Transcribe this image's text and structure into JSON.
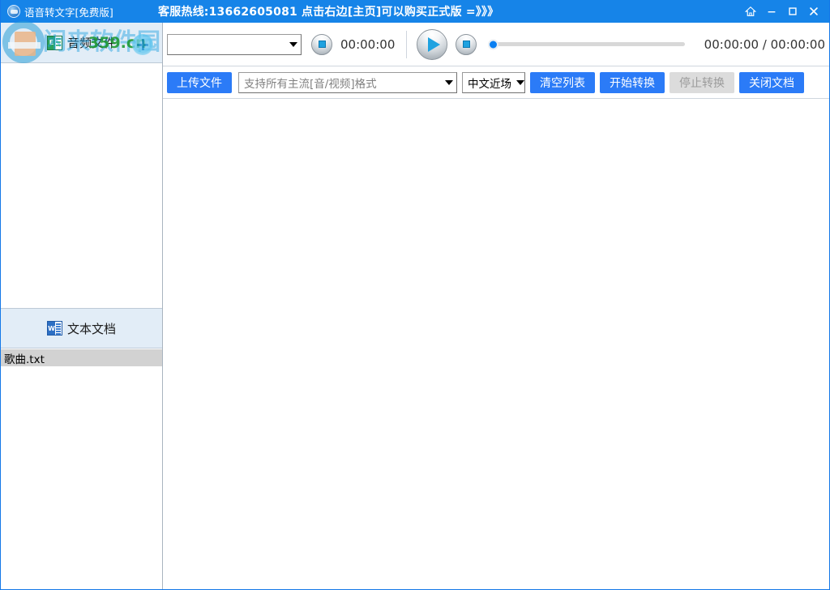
{
  "window": {
    "app_title": "语音转文字[免费版]",
    "banner": "客服热线:13662605081  点击右边[主页]可以购买正式版 =》》》",
    "titlebar_color": "#1684e8",
    "controls": [
      {
        "name": "home",
        "icon": "home-icon"
      },
      {
        "name": "minimize",
        "icon": "minimize-icon"
      },
      {
        "name": "maximize",
        "icon": "maximize-icon"
      },
      {
        "name": "close",
        "icon": "close-icon"
      }
    ]
  },
  "watermark": {
    "brand": "闲来软件园",
    "site": "359.cn",
    "logo": "logo-icon"
  },
  "sidebar": {
    "audio_panel": {
      "title": "音频文件",
      "icon": "audio-file-icon",
      "items": []
    },
    "doc_panel": {
      "title": "文本文档",
      "icon": "word-document-icon",
      "items": [
        {
          "label": "歌曲.txt",
          "selected": true
        }
      ]
    }
  },
  "player": {
    "track_select": {
      "value": "",
      "placeholder": ""
    },
    "stop_small_icon": "stop-icon",
    "elapsed": "00:00:00",
    "play_icon": "play-icon",
    "stop_icon": "stop-icon",
    "progress_percent": 0,
    "time_display": "00:00:00 / 00:00:00"
  },
  "toolbar": {
    "upload_label": "上传文件",
    "file_placeholder": "支持所有主流[音/视频]格式",
    "file_value": "",
    "language_value": "中文近场",
    "clear_label": "清空列表",
    "start_label": "开始转换",
    "stop_label": "停止转换",
    "close_doc_label": "关闭文档",
    "accent_color": "#2b7bf7",
    "disabled_color": "#dcdcdc"
  }
}
